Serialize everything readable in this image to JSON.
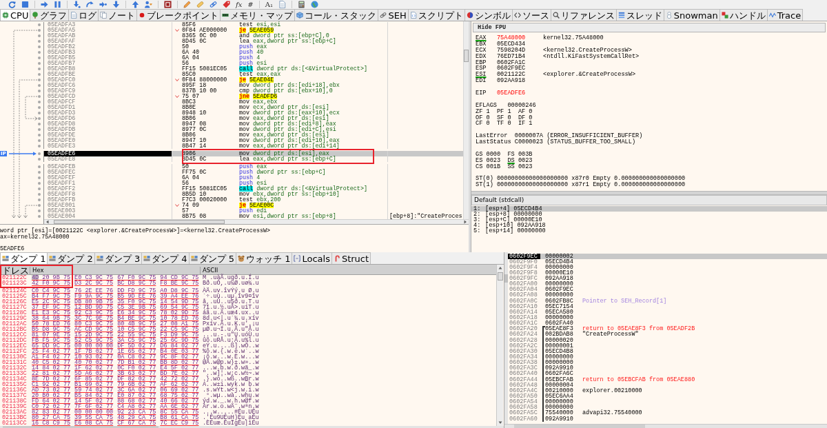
{
  "toolbar": {
    "glyphs": [
      "fx",
      "#",
      "A₁"
    ]
  },
  "tabs": [
    {
      "label": "CPU",
      "selected": true
    },
    {
      "label": "グラフ",
      "selected": false
    },
    {
      "label": "ログ",
      "selected": false
    },
    {
      "label": "ノート",
      "selected": false
    },
    {
      "label": "ブレークポイント",
      "selected": false
    },
    {
      "label": "メモリ・マップ",
      "selected": false
    },
    {
      "label": "コール・スタック",
      "selected": false
    },
    {
      "label": "SEH",
      "selected": false
    },
    {
      "label": "スクリプト",
      "selected": false
    },
    {
      "label": "シンボル",
      "selected": false
    },
    {
      "label": "ソース",
      "selected": false
    },
    {
      "label": "リファレンス",
      "selected": false
    },
    {
      "label": "スレッド",
      "selected": false
    },
    {
      "label": "Snowman",
      "selected": false
    },
    {
      "label": "ハンドル",
      "selected": false
    },
    {
      "label": "Trace",
      "selected": false
    }
  ],
  "disassembly": {
    "ip_label": "IP",
    "rows": [
      {
        "address": "05EADFA3",
        "bytes": "85F6",
        "mnemonic": "test",
        "operands": "esi,esi",
        "kind": "plain",
        "branch": false,
        "selected": false,
        "framed": false
      },
      {
        "address": "05EADFA5",
        "bytes": "0F84 AE000000",
        "mnemonic": "je",
        "operands": "5EAE059",
        "kind": "jump",
        "branch": true,
        "selected": false,
        "framed": false
      },
      {
        "address": "05EADFAB",
        "bytes": "8365 0C 00",
        "mnemonic": "and",
        "operands": "dword ptr ss:[ebp+C],0",
        "kind": "plain",
        "branch": false,
        "selected": false,
        "framed": false
      },
      {
        "address": "05EADFAF",
        "bytes": "8D45 0C",
        "mnemonic": "lea",
        "operands": "eax,dword ptr ss:[ebp+C]",
        "kind": "plain",
        "branch": false,
        "selected": false,
        "framed": false
      },
      {
        "address": "05EADFB2",
        "bytes": "50",
        "mnemonic": "push",
        "operands": "eax",
        "kind": "push",
        "branch": false,
        "selected": false,
        "framed": false
      },
      {
        "address": "05EADFB3",
        "bytes": "6A 40",
        "mnemonic": "push",
        "operands": "40",
        "kind": "push",
        "branch": false,
        "selected": false,
        "framed": false
      },
      {
        "address": "05EADFB5",
        "bytes": "6A 04",
        "mnemonic": "push",
        "operands": "4",
        "kind": "push",
        "branch": false,
        "selected": false,
        "framed": false
      },
      {
        "address": "05EADFB7",
        "bytes": "56",
        "mnemonic": "push",
        "operands": "esi",
        "kind": "push",
        "branch": false,
        "selected": false,
        "framed": false
      },
      {
        "address": "05EADFB8",
        "bytes": "FF15 5081EC05",
        "mnemonic": "call",
        "operands": "dword ptr ds:[<&VirtualProtect>]",
        "kind": "call",
        "branch": false,
        "selected": false,
        "framed": false
      },
      {
        "address": "05EADFBE",
        "bytes": "85C0",
        "mnemonic": "test",
        "operands": "eax,eax",
        "kind": "plain",
        "branch": false,
        "selected": false,
        "framed": false
      },
      {
        "address": "05EADFC0",
        "bytes": "0F84 88000000",
        "mnemonic": "je",
        "operands": "5EAE04E",
        "kind": "jump",
        "branch": true,
        "selected": false,
        "framed": false
      },
      {
        "address": "05EADFC6",
        "bytes": "895F 18",
        "mnemonic": "mov",
        "operands": "dword ptr ds:[edi+18],ebx",
        "kind": "plain",
        "branch": false,
        "selected": false,
        "framed": false
      },
      {
        "address": "05EADFC9",
        "bytes": "837B 10 00",
        "mnemonic": "cmp",
        "operands": "dword ptr ds:[ebx+10],0",
        "kind": "plain",
        "branch": false,
        "selected": false,
        "framed": false
      },
      {
        "address": "05EADFCD",
        "bytes": "75 07",
        "mnemonic": "jne",
        "operands": "5EADFD6",
        "kind": "jump",
        "branch": true,
        "selected": false,
        "framed": false
      },
      {
        "address": "05EADFCF",
        "bytes": "8BC3",
        "mnemonic": "mov",
        "operands": "eax,ebx",
        "kind": "plain",
        "branch": false,
        "selected": false,
        "framed": false
      },
      {
        "address": "05EADFD1",
        "bytes": "8B0E",
        "mnemonic": "mov",
        "operands": "ecx,dword ptr ds:[esi]",
        "kind": "plain",
        "branch": false,
        "selected": false,
        "framed": false
      },
      {
        "address": "05EADFD3",
        "bytes": "8948 10",
        "mnemonic": "mov",
        "operands": "dword ptr ds:[eax+10],ecx",
        "kind": "plain",
        "branch": false,
        "selected": false,
        "framed": false
      },
      {
        "address": "05EADFD6",
        "bytes": "8B06",
        "mnemonic": "mov",
        "operands": "eax,dword ptr ds:[esi]",
        "kind": "plain",
        "branch": false,
        "selected": false,
        "framed": false
      },
      {
        "address": "05EADFD8",
        "bytes": "8947 08",
        "mnemonic": "mov",
        "operands": "dword ptr ds:[edi+8],eax",
        "kind": "plain",
        "branch": false,
        "selected": false,
        "framed": false
      },
      {
        "address": "05EADFDB",
        "bytes": "8977 0C",
        "mnemonic": "mov",
        "operands": "dword ptr ds:[edi+C],esi",
        "kind": "plain",
        "branch": false,
        "selected": false,
        "framed": false
      },
      {
        "address": "05EADFDE",
        "bytes": "8B06",
        "mnemonic": "mov",
        "operands": "eax,dword ptr ds:[esi]",
        "kind": "plain",
        "branch": false,
        "selected": false,
        "framed": false
      },
      {
        "address": "05EADFE0",
        "bytes": "8947 10",
        "mnemonic": "mov",
        "operands": "dword ptr ds:[edi+10],eax",
        "kind": "plain",
        "branch": false,
        "selected": false,
        "framed": false
      },
      {
        "address": "05EADFE3",
        "bytes": "8B47 14",
        "mnemonic": "mov",
        "operands": "eax,dword ptr ds:[edi+14]",
        "kind": "plain",
        "branch": false,
        "selected": false,
        "framed": false
      },
      {
        "address": "05EADFE6",
        "bytes": "8906",
        "mnemonic": "mov",
        "operands": "dword ptr ds:[esi],eax",
        "kind": "plain",
        "branch": false,
        "selected": true,
        "framed": true
      },
      {
        "address": "05EADFE8",
        "bytes": "8D45 0C",
        "mnemonic": "lea",
        "operands": "eax,dword ptr ss:[ebp+C]",
        "kind": "plain",
        "branch": false,
        "selected": false,
        "framed": true
      },
      {
        "address": "05EADFEB",
        "bytes": "50",
        "mnemonic": "push",
        "operands": "eax",
        "kind": "push",
        "branch": false,
        "selected": false,
        "framed": false
      },
      {
        "address": "05EADFEC",
        "bytes": "FF75 0C",
        "mnemonic": "push",
        "operands": "dword ptr ss:[ebp+C]",
        "kind": "push",
        "branch": false,
        "selected": false,
        "framed": false
      },
      {
        "address": "05EADFEF",
        "bytes": "6A 04",
        "mnemonic": "push",
        "operands": "4",
        "kind": "push",
        "branch": false,
        "selected": false,
        "framed": false
      },
      {
        "address": "05EADFF1",
        "bytes": "56",
        "mnemonic": "push",
        "operands": "esi",
        "kind": "push",
        "branch": false,
        "selected": false,
        "framed": false
      },
      {
        "address": "05EADFF2",
        "bytes": "FF15 5081EC05",
        "mnemonic": "call",
        "operands": "dword ptr ds:[<&VirtualProtect>]",
        "kind": "call",
        "branch": false,
        "selected": false,
        "framed": false
      },
      {
        "address": "05EADFF8",
        "bytes": "8B5D 10",
        "mnemonic": "mov",
        "operands": "ebx,dword ptr ss:[ebp+10]",
        "kind": "plain",
        "branch": false,
        "selected": false,
        "framed": false
      },
      {
        "address": "05EADFFB",
        "bytes": "F7C3 00020000",
        "mnemonic": "test",
        "operands": "ebx,200",
        "kind": "plain",
        "branch": false,
        "selected": false,
        "framed": false
      },
      {
        "address": "05EAE001",
        "bytes": "74 09",
        "mnemonic": "je",
        "operands": "5EAE00C",
        "kind": "jump",
        "branch": true,
        "selected": false,
        "framed": false
      },
      {
        "address": "05EAE003",
        "bytes": "57",
        "mnemonic": "push",
        "operands": "edi",
        "kind": "push",
        "branch": false,
        "selected": false,
        "framed": false
      },
      {
        "address": "05EAE004",
        "bytes": "8B75 08",
        "mnemonic": "mov",
        "operands": "esi,dword ptr ss:[ebp+8]",
        "kind": "plain",
        "branch": false,
        "selected": false,
        "framed": false,
        "comment": "[ebp+8]:\"CreateProces"
      }
    ]
  },
  "info_box": {
    "lines": [
      "word ptr [esi]=[0021122C <explorer.&CreateProcessW>]=<kernel32.CreateProcessW>",
      "ax=kernel32.75A48000"
    ],
    "address_line": "5EADFE6"
  },
  "registers": {
    "button": "Hide FPU",
    "sections": [
      {
        "kind": "general",
        "items": [
          {
            "name": "EAX",
            "value": "75A48000",
            "comment": "kernel32.75A48000",
            "changed": true,
            "used": true
          },
          {
            "name": "EBX",
            "value": "05ECD434",
            "changed": false,
            "used": false
          },
          {
            "name": "ECX",
            "value": "7598204D",
            "comment": "<kernel32.CreateProcessW>",
            "changed": false,
            "used": false
          },
          {
            "name": "EDX",
            "value": "76ED71B4",
            "comment": "<ntdll.KiFastSystemCallRet>",
            "changed": false,
            "used": false
          },
          {
            "name": "EBP",
            "value": "0602FA1C",
            "changed": false,
            "used": false
          },
          {
            "name": "ESP",
            "value": "0602F9EC",
            "changed": false,
            "used": false
          },
          {
            "name": "ESI",
            "value": "0021122C",
            "comment": "<explorer.&CreateProcessW>",
            "changed": false,
            "used": true
          },
          {
            "name": "EDI",
            "value": "092AA918",
            "changed": false,
            "used": false
          }
        ]
      },
      {
        "kind": "general",
        "items": [
          {
            "name": "EIP",
            "value": "05EADFE6",
            "changed": true,
            "used": false
          }
        ]
      },
      {
        "kind": "flags",
        "name": "EFLAGS",
        "value": "00000246",
        "rows": [
          {
            "flags": [
              {
                "name": "ZF",
                "value": "1"
              },
              {
                "name": "PF",
                "value": "1"
              },
              {
                "name": "AF",
                "value": "0"
              }
            ]
          },
          {
            "flags": [
              {
                "name": "OF",
                "value": "0"
              },
              {
                "name": "SF",
                "value": "0"
              },
              {
                "name": "DF",
                "value": "0"
              }
            ]
          },
          {
            "flags": [
              {
                "name": "CF",
                "value": "0"
              },
              {
                "name": "TF",
                "value": "0"
              },
              {
                "name": "IF",
                "value": "1"
              }
            ]
          }
        ]
      },
      {
        "kind": "status",
        "items": [
          {
            "name": "LastError",
            "value": "0000007A",
            "comment": "(ERROR_INSUFFICIENT_BUFFER)"
          },
          {
            "name": "LastStatus",
            "value": "C0000023",
            "comment": "(STATUS_BUFFER_TOO_SMALL)"
          }
        ]
      },
      {
        "kind": "segments",
        "rows": [
          {
            "pair": [
              {
                "name": "GS",
                "value": "0000",
                "used": false
              },
              {
                "name": "FS",
                "value": "003B",
                "used": false
              }
            ]
          },
          {
            "pair": [
              {
                "name": "ES",
                "value": "0023",
                "used": false
              },
              {
                "name": "DS",
                "value": "0023",
                "used": true
              }
            ]
          },
          {
            "pair": [
              {
                "name": "CS",
                "value": "001B",
                "used": false
              },
              {
                "name": "SS",
                "value": "0023",
                "used": false
              }
            ]
          }
        ]
      },
      {
        "kind": "fpu",
        "items": [
          {
            "name": "ST(0)",
            "value": "00000000000000000000",
            "tag": "x87r0",
            "state": "Empty",
            "number": "0.000000000000000000"
          },
          {
            "name": "ST(1)",
            "value": "00000000000000000000",
            "tag": "x87r1",
            "state": "Empty",
            "number": "0.000000000000000000"
          }
        ]
      }
    ]
  },
  "call_arguments": {
    "convention": "Default (stdcall)",
    "rows": [
      {
        "index": "1:",
        "location": "[esp+4]",
        "value": "05ECD4B4",
        "selected": true
      },
      {
        "index": "2:",
        "location": "[esp+8]",
        "value": "00000000",
        "selected": false
      },
      {
        "index": "3:",
        "location": "[esp+C]",
        "value": "00000E10",
        "selected": false
      },
      {
        "index": "4:",
        "location": "[esp+10]",
        "value": "092AA918",
        "selected": false
      },
      {
        "index": "5:",
        "location": "[esp+14]",
        "value": "00000000",
        "selected": false
      }
    ]
  },
  "dump_tabs": [
    {
      "label": "ダンプ 1",
      "selected": true
    },
    {
      "label": "ダンプ 2",
      "selected": false
    },
    {
      "label": "ダンプ 3",
      "selected": false
    },
    {
      "label": "ダンプ 4",
      "selected": false
    },
    {
      "label": "ダンプ 5",
      "selected": false
    },
    {
      "label": "ウォッチ 1",
      "selected": false
    },
    {
      "label": "Locals",
      "selected": false
    },
    {
      "label": "Struct",
      "selected": false
    }
  ],
  "dump": {
    "columns": [
      "ドレス",
      "Hex",
      "ASCII"
    ],
    "rows": [
      {
        "address": "021122C",
        "hex": [
          "4D 20 9B 75",
          "E0 C3 9C 75",
          "67 F0 9C 75",
          "94 CD 9C 75"
        ],
        "ascii": "M .uàÃ.ugð.u.Í.u",
        "selected": true,
        "framed": true
      },
      {
        "address": "021123C",
        "hex": [
          "42 F0 9C 75",
          "D3 2C 9C 75",
          "BC D8 9C 75",
          "F8 BE 9C 75"
        ],
        "ascii": "Bð.uÓ,.u¼Ø.uø¾.u",
        "selected": false,
        "framed": true
      },
      {
        "address": "021124C",
        "hex": [
          "C0 C4 9C 75",
          "76 2E EE 76",
          "DD FD 9C 75",
          "A0 D8 9C 75"
        ],
        "ascii": "ÀÄ.uv.îvÝý.u Ø.u",
        "selected": false,
        "framed": false
      },
      {
        "address": "021125C",
        "hex": [
          "B4 F7 9C 75",
          "F9 9A 9C 75",
          "B5 9D EE 76",
          "39 A4 EE 76"
        ],
        "ascii": "´÷.uù..uµ.îv9¤îv",
        "selected": false,
        "framed": false
      },
      {
        "address": "021126C",
        "hex": [
          "E5 2C 9C 75",
          "DB 80 9B 75",
          "35 F0 9C 75",
          "14 54 9D 75"
        ],
        "ascii": "å,.uÛ..u5ð.u.T.u",
        "selected": false,
        "framed": false
      },
      {
        "address": "021127C",
        "hex": [
          "37 EF 9C 75",
          "12 BD 9D 75",
          "C5 3E 9B 75",
          "69 54 9C 75"
        ],
        "ascii": "7ï.u.½.uÅ>.uiT.u",
        "selected": false,
        "framed": false
      },
      {
        "address": "021128C",
        "hex": [
          "E1 E3 9C 75",
          "92 C3 9C 75",
          "E6 34 9C 75",
          "78 02 9D 75"
        ],
        "ascii": "áã.u.Ã.uæ4.ux..u",
        "selected": false,
        "framed": false
      },
      {
        "address": "021129C",
        "hex": [
          "38 64 9B 75",
          "3C 7C 9E 75",
          "B4 BE 9C 75",
          "10 78 ED 76"
        ],
        "ascii": "8d.u<|.u´¾.u.xív",
        "selected": false,
        "framed": false
      },
      {
        "address": "02112AC",
        "hex": [
          "50 78 ED 76",
          "80 C3 9C 75",
          "80 4B 9C 75",
          "27 08 A1 75"
        ],
        "ascii": "Pxív.Ã.u.K.u'.¡u",
        "selected": false,
        "framed": false
      },
      {
        "address": "02112BC",
        "hex": [
          "B5 D8 9C 75",
          "AC CD 9C 75",
          "10 C5 9C 75",
          "22 C5 9C 75"
        ],
        "ascii": "µØ.u¬Í.u.Å.u\"Å.u",
        "selected": false,
        "framed": false
      },
      {
        "address": "02112CC",
        "hex": [
          "81 07 9E 75",
          "15 2D 9C 75",
          "22 55 9C 75",
          "F3 D9 9C 75"
        ],
        "ascii": "...u.-.u\"U.uóÙ.u",
        "selected": false,
        "framed": false
      },
      {
        "address": "02112DC",
        "hex": [
          "FB F5 9C 75",
          "52 C5 9C 75",
          "3A C5 9C 75",
          "25 6C 9D 75"
        ],
        "ascii": "ûõ.uRÅ.u:Å.u%l.u",
        "selected": false,
        "framed": false
      },
      {
        "address": "02112EC",
        "hex": [
          "65 DD 9C 75",
          "00 00 00 00",
          "DF 5D 02 77",
          "D6 84 02 77"
        ],
        "ascii": "eÝ.u....ß].wÖ..w",
        "selected": false,
        "framed": false
      },
      {
        "address": "02112FC",
        "hex": [
          "25 F4 02 77",
          "1F 7B 02 77",
          "1E 65 02 77",
          "B4 0E 03 77"
        ],
        "ascii": "%ô.w.{.w.e.w´..w",
        "selected": false,
        "framed": false
      },
      {
        "address": "021130C",
        "hex": [
          "A1 F4 02 77",
          "10 93 02 77",
          "0A C8 02 77",
          "9C 8F 02 77"
        ],
        "ascii": "¡ô.w...w.È.w...w",
        "selected": false,
        "framed": false
      },
      {
        "address": "021131C",
        "hex": [
          "40 C5 02 77",
          "40 70 02 77",
          "7D B1 02 77",
          "BB 8D 02 77"
        ],
        "ascii": "@Å.w@p.w}±.w»..w",
        "selected": false,
        "framed": false
      },
      {
        "address": "021132C",
        "hex": [
          "14 84 02 77",
          "1F 62 02 77",
          "0C F0 02 77",
          "E4 5F 02 77"
        ],
        "ascii": "...w.b.w.ð.wä_.w",
        "selected": false,
        "framed": false
      },
      {
        "address": "021133C",
        "hex": [
          "22 81 02 77",
          "5D A6 02 77",
          "3B 63 02 77",
          "BD 7E 02 77"
        ],
        "ascii": "\"..w]¦.w;c.w½~.w",
        "selected": false,
        "framed": false
      },
      {
        "address": "021134C",
        "hex": [
          "8E 7D 02 77",
          "6F 85 02 77",
          "DF 82 02 77",
          "42 72 02 77"
        ],
        "ascii": ".}.wo..wß..wBr.w",
        "selected": false,
        "framed": false
      },
      {
        "address": "021135C",
        "hex": [
          "C1 92 02 77",
          "B1 69 02 77",
          "79 6B 02 77",
          "AF 62 02 77"
        ],
        "ascii": "Á..w±i.wyk.w¯b.w",
        "selected": false,
        "framed": false
      },
      {
        "address": "021136C",
        "hex": [
          "AD 73 02 77",
          "59 74 02 77",
          "3C 6A 02 77",
          "06 69 02 77"
        ],
        "ascii": ".s.wYt.w<j.w.i.w",
        "selected": false,
        "framed": false
      },
      {
        "address": "021137C",
        "hex": [
          "20 B0 02 77",
          "B5 84 02 77",
          "E0 87 02 77",
          "68 75 02 77"
        ],
        "ascii": " °.wµ..wà..whu.w",
        "selected": false,
        "framed": false
      },
      {
        "address": "021138C",
        "hex": [
          "FD 64 02 77",
          "14 5F 02 77",
          "88 68 02 77",
          "40 66 02 77"
        ],
        "ascii": "ýd.w._.w.h.w@f.w",
        "selected": false,
        "framed": false
      },
      {
        "address": "021139C",
        "hex": [
          "C0 72 02 77",
          "7F 6F 02 77",
          "C4 A8 02 77",
          "AA 6E 02 77"
        ],
        "ascii": "Àr.w.o.wÄ¨.wªn.w",
        "selected": false,
        "framed": false
      },
      {
        "address": "02113AC",
        "hex": [
          "82 83 02 77",
          "00 00 00 00",
          "92 23 CA 75",
          "8C 55 CA 75"
        ],
        "ascii": "...w.....#Êu.UÊu",
        "selected": false,
        "framed": false
      },
      {
        "address": "02113BC",
        "hex": [
          "80 27 CA 75",
          "39 55 CA 75",
          "48 29 CA 75",
          "B8 61 CA 75"
        ],
        "ascii": ".'Êu9UÊuH)Êu¸aÊu",
        "selected": false,
        "framed": false
      },
      {
        "address": "02113CC",
        "hex": [
          "16 C8 C9 75",
          "E6 08 CA 75",
          "CF 67 CA 75",
          "7C EC C9 75"
        ],
        "ascii": ".ÈÉuæ.ÊuÏgÊu|ìÉu",
        "selected": false,
        "framed": false
      }
    ]
  },
  "stack": {
    "rows": [
      {
        "address": "0602F9EC",
        "value": "00000002",
        "selected": true,
        "in_frame": false
      },
      {
        "address": "0602F9F0",
        "value": "05ECD4B4",
        "selected": false,
        "in_frame": false
      },
      {
        "address": "0602F9F4",
        "value": "00000000",
        "selected": false,
        "in_frame": false
      },
      {
        "address": "0602F9F8",
        "value": "00000E10",
        "selected": false,
        "in_frame": false
      },
      {
        "address": "0602F9FC",
        "value": "092AA918",
        "selected": false,
        "in_frame": false
      },
      {
        "address": "0602FA00",
        "value": "00000000",
        "selected": false,
        "in_frame": false
      },
      {
        "address": "0602FA04",
        "value": "0602F9EC",
        "selected": false,
        "in_frame": false
      },
      {
        "address": "0602FA08",
        "value": "00000000",
        "selected": false,
        "in_frame": false
      },
      {
        "address": "0602FA0C",
        "value": "0602FB8C",
        "selected": false,
        "in_frame": false,
        "comment": {
          "text": "Pointer to SEH_Record[1]",
          "kind": "pointer"
        }
      },
      {
        "address": "0602FA10",
        "value": "05EC7154",
        "selected": false,
        "in_frame": false
      },
      {
        "address": "0602FA14",
        "value": "05ECA580",
        "selected": false,
        "in_frame": false
      },
      {
        "address": "0602FA18",
        "value": "00000000",
        "selected": false,
        "in_frame": false
      },
      {
        "address": "0602FA1C",
        "value": "0602FA40",
        "selected": false,
        "in_frame": false
      },
      {
        "address": "0602FA20",
        "value": "05EAE8F3",
        "selected": false,
        "in_frame": true,
        "comment": {
          "text": "return to 05EAE8F3 from 05EADF2B",
          "kind": "return"
        }
      },
      {
        "address": "0602FA24",
        "value": "002BDAB8",
        "selected": false,
        "in_frame": true,
        "comment": {
          "text": "\"CreateProcessW\"",
          "kind": "plain"
        }
      },
      {
        "address": "0602FA28",
        "value": "00000020",
        "selected": false,
        "in_frame": true
      },
      {
        "address": "0602FA2C",
        "value": "00000001",
        "selected": false,
        "in_frame": true
      },
      {
        "address": "0602FA30",
        "value": "05ECD4B8",
        "selected": false,
        "in_frame": true
      },
      {
        "address": "0602FA34",
        "value": "00000000",
        "selected": false,
        "in_frame": true
      },
      {
        "address": "0602FA38",
        "value": "00000000",
        "selected": false,
        "in_frame": true
      },
      {
        "address": "0602FA3C",
        "value": "092A9910",
        "selected": false,
        "in_frame": true
      },
      {
        "address": "0602FA40",
        "value": "0602FA6C",
        "selected": false,
        "in_frame": true
      },
      {
        "address": "0602FA44",
        "value": "05EBCFAB",
        "selected": false,
        "in_frame": true,
        "comment": {
          "text": "return to 05EBCFAB from 05EAE880",
          "kind": "return"
        }
      },
      {
        "address": "0602FA48",
        "value": "00000004",
        "selected": false,
        "in_frame": true
      },
      {
        "address": "0602FA4C",
        "value": "00210000",
        "selected": false,
        "in_frame": true,
        "comment": {
          "text": "explorer.00210000",
          "kind": "plain"
        }
      },
      {
        "address": "0602FA50",
        "value": "05EC6AA4",
        "selected": false,
        "in_frame": true
      },
      {
        "address": "0602FA54",
        "value": "00000000",
        "selected": false,
        "in_frame": true
      },
      {
        "address": "0602FA58",
        "value": "00000000",
        "selected": false,
        "in_frame": true
      },
      {
        "address": "0602FA5C",
        "value": "75540000",
        "selected": false,
        "in_frame": true,
        "comment": {
          "text": "advapi32.75540000",
          "kind": "plain"
        }
      },
      {
        "address": "0602FA60",
        "value": "092A9910",
        "selected": false,
        "in_frame": true
      }
    ]
  }
}
